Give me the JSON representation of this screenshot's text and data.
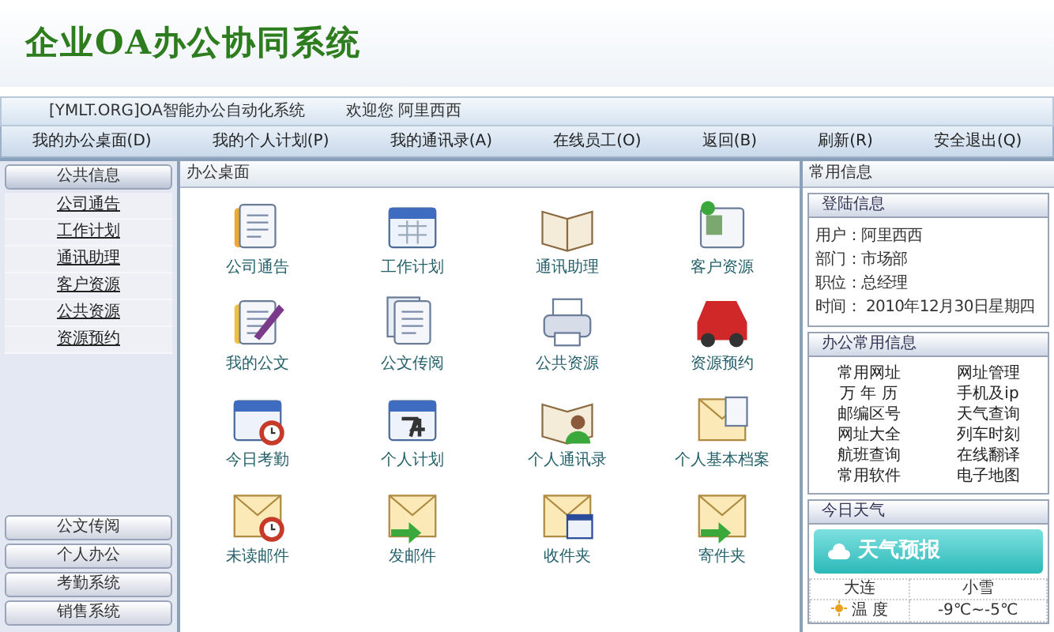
{
  "app_title": "企业OA办公协同系统",
  "info_bar": {
    "site": "[YMLT.ORG]OA智能办公自动化系统",
    "welcome": "欢迎您 阿里西西"
  },
  "nav": [
    "我的办公桌面(D)",
    "我的个人计划(P)",
    "我的通讯录(A)",
    "在线员工(O)",
    "返回(B)",
    "刷新(R)",
    "安全退出(Q)"
  ],
  "sidebar": {
    "groups": [
      {
        "label": "公共信息",
        "expanded": true,
        "children": [
          "公司通告",
          "工作计划",
          "通讯助理",
          "客户资源",
          "公共资源",
          "资源预约"
        ]
      },
      {
        "label": "公文传阅",
        "expanded": false
      },
      {
        "label": "个人办公",
        "expanded": false
      },
      {
        "label": "考勤系统",
        "expanded": false
      },
      {
        "label": "销售系统",
        "expanded": false
      }
    ]
  },
  "desktop": {
    "title": "办公桌面",
    "items": [
      {
        "label": "公司通告",
        "kind": "notes"
      },
      {
        "label": "工作计划",
        "kind": "calendar"
      },
      {
        "label": "通讯助理",
        "kind": "book"
      },
      {
        "label": "客户资源",
        "kind": "card"
      },
      {
        "label": "我的公文",
        "kind": "pen"
      },
      {
        "label": "公文传阅",
        "kind": "papers"
      },
      {
        "label": "公共资源",
        "kind": "printer"
      },
      {
        "label": "资源预约",
        "kind": "car"
      },
      {
        "label": "今日考勤",
        "kind": "calendar-clock"
      },
      {
        "label": "个人计划",
        "kind": "date"
      },
      {
        "label": "个人通讯录",
        "kind": "book-person"
      },
      {
        "label": "个人基本档案",
        "kind": "mail-card"
      },
      {
        "label": "未读邮件",
        "kind": "mail-clock"
      },
      {
        "label": "发邮件",
        "kind": "mail-arrow"
      },
      {
        "label": "收件夹",
        "kind": "mail-window"
      },
      {
        "label": "寄件夹",
        "kind": "mail-arrow"
      }
    ]
  },
  "info_panel": {
    "title": "常用信息",
    "login": {
      "title": "登陆信息",
      "lines": [
        "用户：阿里西西",
        "部门：市场部",
        "职位：总经理",
        "时间： 2010年12月30日星期四"
      ]
    },
    "links": {
      "title": "办公常用信息",
      "items": [
        "常用网址",
        "网址管理",
        "万 年 历",
        "手机及ip",
        "邮编区号",
        "天气查询",
        "网址大全",
        "列车时刻",
        "航班查询",
        "在线翻译",
        "常用软件",
        "电子地图"
      ]
    },
    "weather": {
      "title": "今日天气",
      "banner": "天气预报",
      "city": "大连",
      "condition": "小雪",
      "temp_label": "温 度",
      "temp": "-9℃~-5℃"
    }
  }
}
